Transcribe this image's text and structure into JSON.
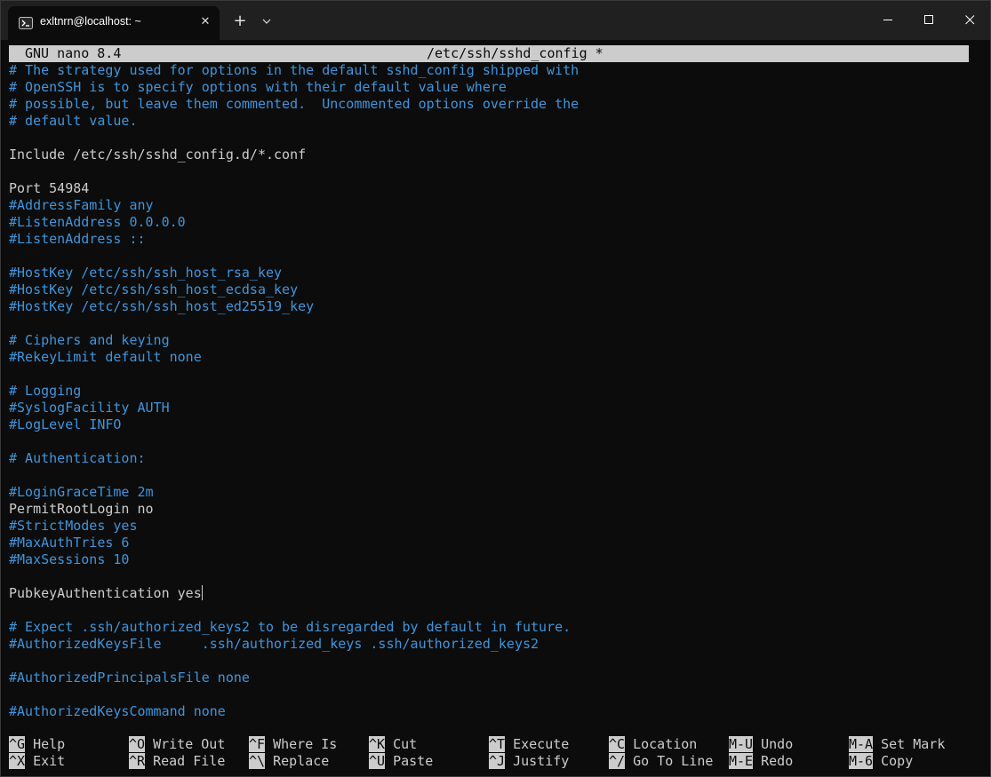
{
  "window": {
    "tab_title": "exltnrn@localhost: ~",
    "tab_close_glyph": "✕",
    "new_tab_glyph": "+",
    "dropdown_glyph": "⌄",
    "icons": [
      "terminal-icon",
      "close-icon",
      "plus-icon",
      "chevron-down-icon",
      "minimize-icon",
      "maximize-icon",
      "close-window-icon"
    ]
  },
  "nano": {
    "version_label": "GNU nano 8.4",
    "file_label": "/etc/ssh/sshd_config *"
  },
  "lines": [
    {
      "text": "# The strategy used for options in the default sshd_config shipped with",
      "type": "comment"
    },
    {
      "text": "# OpenSSH is to specify options with their default value where",
      "type": "comment"
    },
    {
      "text": "# possible, but leave them commented.  Uncommented options override the",
      "type": "comment"
    },
    {
      "text": "# default value.",
      "type": "comment"
    },
    {
      "text": "",
      "type": "normal"
    },
    {
      "text": "Include /etc/ssh/sshd_config.d/*.conf",
      "type": "normal"
    },
    {
      "text": "",
      "type": "normal"
    },
    {
      "text": "Port 54984",
      "type": "normal"
    },
    {
      "text": "#AddressFamily any",
      "type": "comment"
    },
    {
      "text": "#ListenAddress 0.0.0.0",
      "type": "comment"
    },
    {
      "text": "#ListenAddress ::",
      "type": "comment"
    },
    {
      "text": "",
      "type": "normal"
    },
    {
      "text": "#HostKey /etc/ssh/ssh_host_rsa_key",
      "type": "comment"
    },
    {
      "text": "#HostKey /etc/ssh/ssh_host_ecdsa_key",
      "type": "comment"
    },
    {
      "text": "#HostKey /etc/ssh/ssh_host_ed25519_key",
      "type": "comment"
    },
    {
      "text": "",
      "type": "normal"
    },
    {
      "text": "# Ciphers and keying",
      "type": "comment"
    },
    {
      "text": "#RekeyLimit default none",
      "type": "comment"
    },
    {
      "text": "",
      "type": "normal"
    },
    {
      "text": "# Logging",
      "type": "comment"
    },
    {
      "text": "#SyslogFacility AUTH",
      "type": "comment"
    },
    {
      "text": "#LogLevel INFO",
      "type": "comment"
    },
    {
      "text": "",
      "type": "normal"
    },
    {
      "text": "# Authentication:",
      "type": "comment"
    },
    {
      "text": "",
      "type": "normal"
    },
    {
      "text": "#LoginGraceTime 2m",
      "type": "comment"
    },
    {
      "text": "PermitRootLogin no",
      "type": "normal"
    },
    {
      "text": "#StrictModes yes",
      "type": "comment"
    },
    {
      "text": "#MaxAuthTries 6",
      "type": "comment"
    },
    {
      "text": "#MaxSessions 10",
      "type": "comment"
    },
    {
      "text": "",
      "type": "normal"
    },
    {
      "text": "PubkeyAuthentication yes",
      "type": "normal",
      "cursor": true
    },
    {
      "text": "",
      "type": "normal"
    },
    {
      "text": "# Expect .ssh/authorized_keys2 to be disregarded by default in future.",
      "type": "comment"
    },
    {
      "text": "#AuthorizedKeysFile     .ssh/authorized_keys .ssh/authorized_keys2",
      "type": "comment"
    },
    {
      "text": "",
      "type": "normal"
    },
    {
      "text": "#AuthorizedPrincipalsFile none",
      "type": "comment"
    },
    {
      "text": "",
      "type": "normal"
    },
    {
      "text": "#AuthorizedKeysCommand none",
      "type": "comment"
    }
  ],
  "shortcuts": [
    [
      {
        "key": "^G",
        "label": "Help"
      },
      {
        "key": "^O",
        "label": "Write Out"
      },
      {
        "key": "^F",
        "label": "Where Is"
      },
      {
        "key": "^K",
        "label": "Cut"
      },
      {
        "key": "^T",
        "label": "Execute"
      },
      {
        "key": "^C",
        "label": "Location"
      },
      {
        "key": "M-U",
        "label": "Undo"
      },
      {
        "key": "M-A",
        "label": "Set Mark"
      }
    ],
    [
      {
        "key": "^X",
        "label": "Exit"
      },
      {
        "key": "^R",
        "label": "Read File"
      },
      {
        "key": "^\\",
        "label": "Replace"
      },
      {
        "key": "^U",
        "label": "Paste"
      },
      {
        "key": "^J",
        "label": "Justify"
      },
      {
        "key": "^/",
        "label": "Go To Line"
      },
      {
        "key": "M-E",
        "label": "Redo"
      },
      {
        "key": "M-6",
        "label": "Copy"
      }
    ]
  ],
  "colors": {
    "comment": "#3a96dd",
    "text": "#cccccc",
    "background": "#0c0c0c",
    "titlebar": "#202020",
    "bar": "#cccccc"
  }
}
